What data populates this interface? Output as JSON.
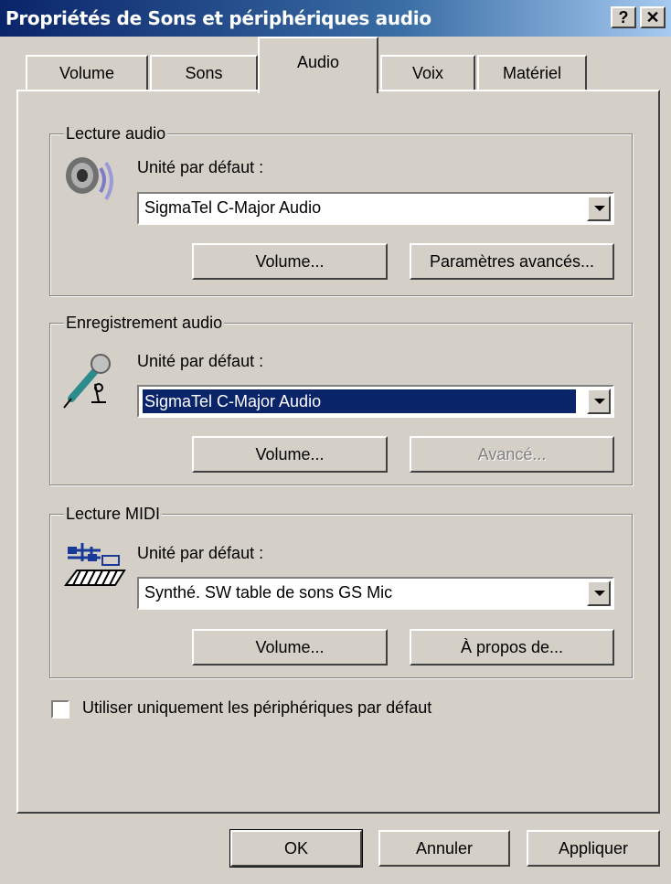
{
  "window": {
    "title": "Propriétés de Sons et périphériques audio",
    "help_button": "?",
    "close_button": "✕"
  },
  "tabs": [
    "Volume",
    "Sons",
    "Audio",
    "Voix",
    "Matériel"
  ],
  "active_tab": "Audio",
  "playback": {
    "legend": "Lecture audio",
    "icon": "speaker-icon",
    "device_label": "Unité par défaut :",
    "device_value": "SigmaTel C-Major Audio",
    "volume_button": "Volume...",
    "advanced_button": "Paramètres avancés..."
  },
  "recording": {
    "legend": "Enregistrement audio",
    "icon": "microphone-icon",
    "device_label": "Unité par défaut :",
    "device_value": "SigmaTel C-Major Audio",
    "volume_button": "Volume...",
    "advanced_button": "Avancé..."
  },
  "midi": {
    "legend": "Lecture MIDI",
    "icon": "midi-keyboard-icon",
    "device_label": "Unité par défaut :",
    "device_value": "Synthé. SW table de sons GS Mic",
    "volume_button": "Volume...",
    "about_button": "À propos de..."
  },
  "default_only_checkbox": {
    "label": "Utiliser uniquement les périphériques par défaut",
    "checked": false
  },
  "footer": {
    "ok": "OK",
    "cancel": "Annuler",
    "apply": "Appliquer"
  },
  "colors": {
    "titlebar_start": "#0a246a",
    "titlebar_end": "#a6caf0",
    "face": "#d4d0c8",
    "selection": "#0a246a"
  }
}
